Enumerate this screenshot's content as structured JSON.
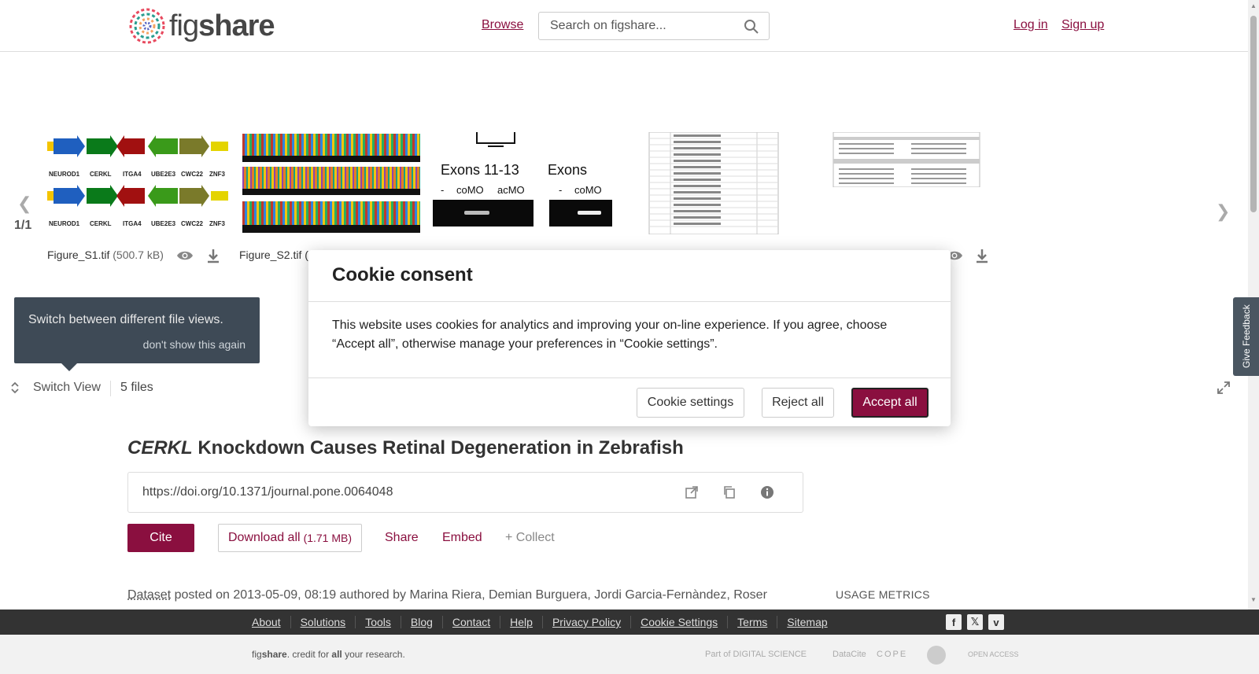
{
  "header": {
    "logo_fig": "fig",
    "logo_share": "share",
    "browse_label": "Browse",
    "search_placeholder": "Search on figshare...",
    "login_label": "Log in",
    "signup_label": "Sign up"
  },
  "carousel": {
    "pager": "1/1",
    "files": [
      {
        "name": "Figure_S1.tif",
        "size": "(500.7 kB)"
      },
      {
        "name": "Figure_S2.tif",
        "size": "("
      }
    ],
    "figure_s1_genes": [
      "NEUROD1",
      "CERKL",
      "ITGA4",
      "UBE2E3",
      "CWC22",
      "ZNF3"
    ],
    "exon_labels": {
      "exons_1": "Exons 11-13",
      "exons_2": "Exons",
      "comdo": "coMO",
      "acmo": "acMO",
      "minus": "-"
    }
  },
  "tip": {
    "text": "Switch between different file views.",
    "dismiss": "don't show this again"
  },
  "switch_bar": {
    "label": "Switch View",
    "files_count": "5 files"
  },
  "feedback_label": "Give Feedback",
  "item": {
    "title_italic": "CERKL",
    "title_rest": " Knockdown Causes Retinal Degeneration in Zebrafish",
    "doi": "https://doi.org/10.1371/journal.pone.0064048",
    "cite_label": "Cite",
    "download_label": "Download all",
    "download_size": "(1.71 MB)",
    "share_label": "Share",
    "embed_label": "Embed",
    "collect_label": "+ Collect",
    "dataset_label": "Dataset",
    "posted_text": " posted on 2013-05-09, 08:19 authored by Marina Riera, Demian Burguera, Jordi Garcia-Fernàndez, Roser",
    "usage_label": "USAGE METRICS"
  },
  "footer": {
    "links": [
      "About",
      "Solutions",
      "Tools",
      "Blog",
      "Contact",
      "Help",
      "Privacy Policy",
      "Cookie Settings",
      "Terms",
      "Sitemap"
    ],
    "credit_fig": "fig",
    "credit_share": "share",
    "credit_mid": ". credit for ",
    "credit_all": "all",
    "credit_end": " your research.",
    "partners": [
      "Part of DIGITAL SCIENCE",
      "DataCite",
      "COPE",
      "",
      "OPEN ACCESS"
    ]
  },
  "cookie": {
    "title": "Cookie consent",
    "body": "This website uses cookies for analytics and improving your on-line experience. If you agree, choose “Accept all”, otherwise manage your preferences in “Cookie settings”.",
    "settings_label": "Cookie settings",
    "reject_label": "Reject all",
    "accept_label": "Accept all"
  },
  "colors": {
    "brand": "#8a0f3f",
    "tooltip_bg": "#3e4a56",
    "footer_bg": "#333333"
  }
}
